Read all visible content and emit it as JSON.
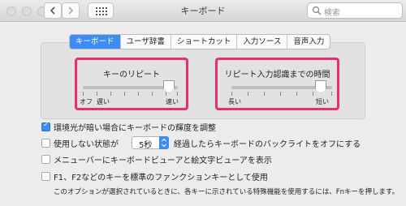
{
  "window": {
    "title": "キーボード"
  },
  "search": {
    "placeholder": "検索"
  },
  "tabs": [
    {
      "label": "キーボード",
      "active": true
    },
    {
      "label": "ユーザ辞書",
      "active": false
    },
    {
      "label": "ショートカット",
      "active": false
    },
    {
      "label": "入力ソース",
      "active": false
    },
    {
      "label": "音声入力",
      "active": false
    }
  ],
  "key_repeat": {
    "title": "キーのリピート",
    "labels": [
      "オフ",
      "遅い",
      "速い"
    ],
    "level": 0.93
  },
  "repeat_delay": {
    "title": "リピート入力認識までの時間",
    "labels": [
      "長い",
      "短い"
    ],
    "level": 0.86
  },
  "options": [
    {
      "label": "環境光が暗い場合にキーボードの輝度を調整",
      "checked": true
    },
    {
      "label_before": "使用しない状態が",
      "select_value": "5秒",
      "label_after": "経過したらキーボードのバックライトをオフにする",
      "checked": false
    },
    {
      "label": "メニューバーにキーボードビューアと絵文字ビューアを表示",
      "checked": false
    },
    {
      "label": "F1、F2などのキーを標準のファンクションキーとして使用",
      "checked": false,
      "note": "このオプションが選択されているときに、各キーに示されている特殊機能を使用するには、Fnキーを押します。"
    }
  ],
  "colors": {
    "accent": "#3b8cf3",
    "highlight": "#ea2e6e"
  }
}
